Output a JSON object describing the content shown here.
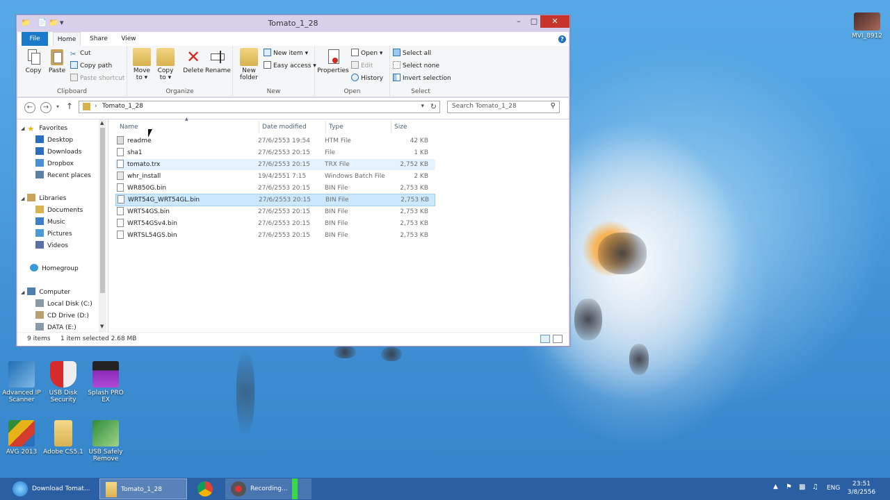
{
  "window": {
    "title": "Tomato_1_28",
    "minimize": "–",
    "maximize": "□",
    "close": "✕"
  },
  "ribbon": {
    "tabs": [
      "File",
      "Home",
      "Share",
      "View"
    ],
    "clipboard": {
      "label": "Clipboard",
      "copy": "Copy",
      "paste": "Paste",
      "cut": "Cut",
      "copy_path": "Copy path",
      "paste_shortcut": "Paste shortcut"
    },
    "organize": {
      "label": "Organize",
      "move_to": "Move\nto ▾",
      "copy_to": "Copy\nto ▾",
      "delete": "Delete",
      "rename": "Rename"
    },
    "new": {
      "label": "New",
      "new_folder": "New\nfolder",
      "new_item": "New item ▾",
      "easy_access": "Easy access ▾"
    },
    "open": {
      "label": "Open",
      "properties": "Properties",
      "open": "Open ▾",
      "edit": "Edit",
      "history": "History"
    },
    "select": {
      "label": "Select",
      "select_all": "Select all",
      "select_none": "Select none",
      "invert_selection": "Invert selection"
    }
  },
  "address": {
    "path": "Tomato_1_28",
    "search_placeholder": "Search Tomato_1_28"
  },
  "nav": {
    "favorites": "Favorites",
    "desktop": "Desktop",
    "downloads": "Downloads",
    "dropbox": "Dropbox",
    "recent": "Recent places",
    "libraries": "Libraries",
    "documents": "Documents",
    "music": "Music",
    "pictures": "Pictures",
    "videos": "Videos",
    "homegroup": "Homegroup",
    "computer": "Computer",
    "local_disk": "Local Disk (C:)",
    "cd_drive": "CD Drive (D:)",
    "data": "DATA (E:)"
  },
  "columns": {
    "name": "Name",
    "date": "Date modified",
    "type": "Type",
    "size": "Size"
  },
  "files": [
    {
      "name": "readme",
      "date": "27/6/2553 19:54",
      "type": "HTM File",
      "size": "42 KB"
    },
    {
      "name": "sha1",
      "date": "27/6/2553 20:15",
      "type": "File",
      "size": "1 KB"
    },
    {
      "name": "tomato.trx",
      "date": "27/6/2553 20:15",
      "type": "TRX File",
      "size": "2,752 KB"
    },
    {
      "name": "whr_install",
      "date": "19/4/2551 7:15",
      "type": "Windows Batch File",
      "size": "2 KB"
    },
    {
      "name": "WR850G.bin",
      "date": "27/6/2553 20:15",
      "type": "BIN File",
      "size": "2,753 KB"
    },
    {
      "name": "WRT54G_WRT54GL.bin",
      "date": "27/6/2553 20:15",
      "type": "BIN File",
      "size": "2,753 KB"
    },
    {
      "name": "WRT54GS.bin",
      "date": "27/6/2553 20:15",
      "type": "BIN File",
      "size": "2,753 KB"
    },
    {
      "name": "WRT54GSv4.bin",
      "date": "27/6/2553 20:15",
      "type": "BIN File",
      "size": "2,753 KB"
    },
    {
      "name": "WRTSL54GS.bin",
      "date": "27/6/2553 20:15",
      "type": "BIN File",
      "size": "2,753 KB"
    }
  ],
  "status": {
    "count": "9 items",
    "selected": "1 item selected  2.68 MB"
  },
  "desktop_icons": {
    "advanced_ip": "Advanced IP\nScanner",
    "usb_disk": "USB Disk\nSecurity",
    "splash": "Splash PRO\nEX",
    "avg": "AVG 2013",
    "adobe": "Adobe CS5.1",
    "usb_safely": "USB Safely\nRemove",
    "mvi": "MVI_8912"
  },
  "taskbar": {
    "ie_task": "Download Tomat...",
    "explorer_task": "Tomato_1_28",
    "recording_task": "Recording...",
    "lang": "ENG",
    "time": "23:51",
    "date": "3/8/2556"
  },
  "colors": {
    "selection": "#cce8ff",
    "file_tab": "#1979ca",
    "close_button": "#c7342b",
    "taskbar": "#2a5fa4"
  }
}
